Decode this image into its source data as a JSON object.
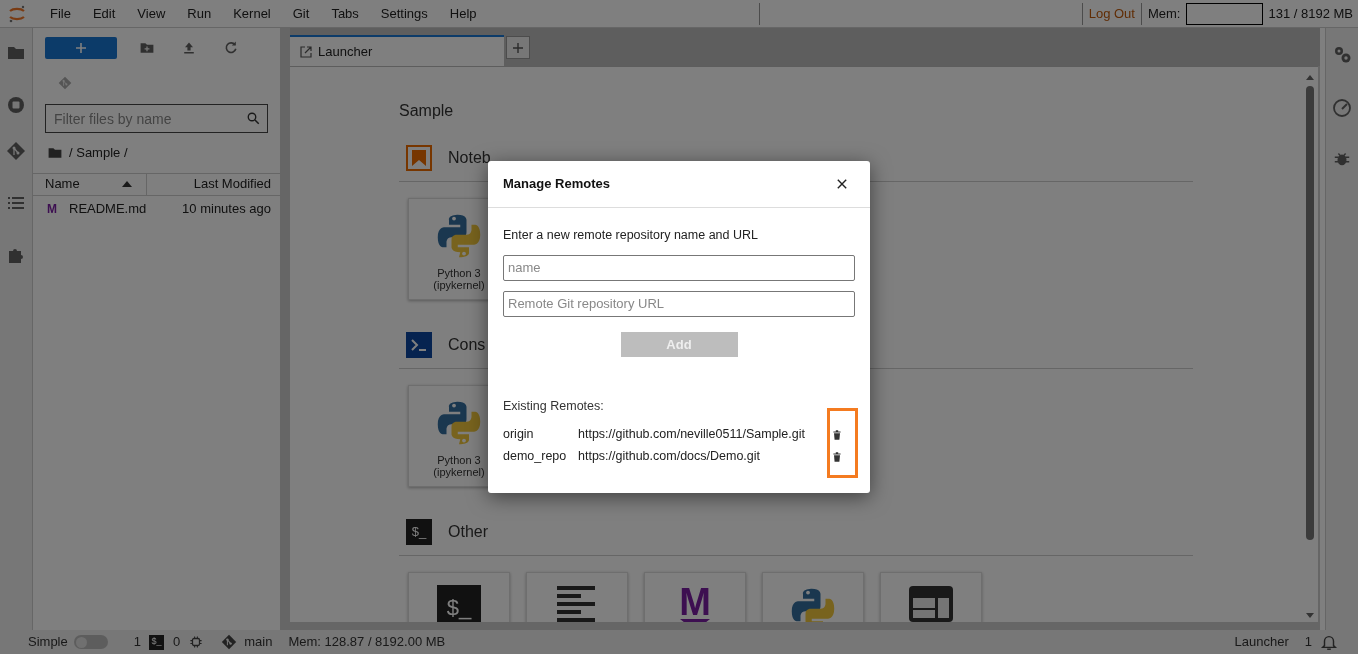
{
  "menu_bar": {
    "items": [
      "File",
      "Edit",
      "View",
      "Run",
      "Kernel",
      "Git",
      "Tabs",
      "Settings",
      "Help"
    ],
    "log_out": "Log Out",
    "mem_label": "Mem:",
    "mem_reading": "131 / 8192 MB"
  },
  "file_browser": {
    "filter": {
      "placeholder": "Filter files by name"
    },
    "breadcrumb": "/ Sample /",
    "columns": [
      "Name",
      "Last Modified"
    ],
    "files": [
      {
        "glyph": "M",
        "name": "README.md",
        "modified": "10 minutes ago"
      }
    ]
  },
  "tabs": [
    {
      "label": "Launcher",
      "selected": true
    }
  ],
  "launcher": {
    "title": "Sample",
    "sections": [
      {
        "kind": "notebook",
        "label": "Noteb",
        "cards": [
          {
            "kind": "python",
            "label": "Python 3 (ipykernel)"
          }
        ]
      },
      {
        "kind": "console",
        "label": "Cons",
        "cards": [
          {
            "kind": "python",
            "label": "Python 3 (ipykernel)"
          }
        ]
      },
      {
        "kind": "other",
        "label": "Other",
        "glyph": "$_",
        "cards": [
          {
            "kind": "terminal",
            "glyph": "$_"
          },
          {
            "kind": "text"
          },
          {
            "kind": "markdown",
            "glyph": "M"
          },
          {
            "kind": "python"
          },
          {
            "kind": "layout"
          }
        ]
      }
    ]
  },
  "dialog": {
    "title": "Manage Remotes",
    "prompt": "Enter a new remote repository name and URL",
    "name_field": {
      "placeholder": "name"
    },
    "url_field": {
      "placeholder": "Remote Git repository URL"
    },
    "add_button": {
      "label": "Add",
      "disabled": true
    },
    "existing_label": "Existing Remotes:",
    "remotes": [
      {
        "name": "origin",
        "url": "https://github.com/neville0511/Sample.git"
      },
      {
        "name": "demo_repo",
        "url": "https://github.com/docs/Demo.git"
      }
    ]
  },
  "status_bar": {
    "mode_label": "Simple",
    "simple_on": false,
    "terminals": "1",
    "terminal_glyph": "$_",
    "kernels": "0",
    "branch": "main",
    "memory": "Mem: 128.87 / 8192.00 MB",
    "active": "Launcher",
    "notifications": "1"
  }
}
